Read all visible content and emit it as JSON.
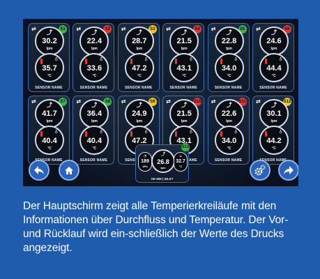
{
  "badge_colors": {
    "green": "#3cb34a",
    "red": "#e0363a",
    "yellow": "#f0c419"
  },
  "sensors": [
    {
      "badge": "S1",
      "badge_color": "green",
      "flow": "30.2",
      "flow_unit": "lpm",
      "temp": "35.7",
      "temp_unit": "°C",
      "name": "SENSOR NAME"
    },
    {
      "badge": "S2",
      "badge_color": "red",
      "flow": "22.4",
      "flow_unit": "lpm",
      "temp": "33.6",
      "temp_unit": "°C",
      "name": "SENSOR NAME"
    },
    {
      "badge": "S3",
      "badge_color": "yellow",
      "flow": "28.7",
      "flow_unit": "lpm",
      "temp": "47.2",
      "temp_unit": "°C",
      "name": "SENSOR NAME"
    },
    {
      "badge": "S4",
      "badge_color": "red",
      "flow": "21.5",
      "flow_unit": "lpm",
      "temp": "43.1",
      "temp_unit": "°C",
      "name": "SENSOR NAME"
    },
    {
      "badge": "S5",
      "badge_color": "green",
      "flow": "22.8",
      "flow_unit": "lpm",
      "temp": "34.0",
      "temp_unit": "°C",
      "name": "SENSOR NAME"
    },
    {
      "badge": "S6",
      "badge_color": "red",
      "flow": "24.6",
      "flow_unit": "lpm",
      "temp": "44.4",
      "temp_unit": "°C",
      "name": "SENSOR NAME"
    },
    {
      "badge": "S7",
      "badge_color": "green",
      "flow": "41.7",
      "flow_unit": "lpm",
      "temp": "40.4",
      "temp_unit": "°C",
      "name": "SENSOR NAME"
    },
    {
      "badge": "S8",
      "badge_color": "green",
      "flow": "36.4",
      "flow_unit": "lpm",
      "temp": "40.4",
      "temp_unit": "°C",
      "name": "SENSOR NAME"
    },
    {
      "badge": "S9",
      "badge_color": "yellow",
      "flow": "24.9",
      "flow_unit": "lpm",
      "temp": "47.2",
      "temp_unit": "°C",
      "name": "SENSOR NAME"
    },
    {
      "badge": "S10",
      "badge_color": "red",
      "flow": "21.5",
      "flow_unit": "lpm",
      "temp": "43.1",
      "temp_unit": "°C",
      "name": "SENSOR NAME"
    },
    {
      "badge": "S11",
      "badge_color": "red",
      "flow": "22.6",
      "flow_unit": "lpm",
      "temp": "34.0",
      "temp_unit": "°C",
      "name": "SENSOR NAME"
    },
    {
      "badge": "S12",
      "badge_color": "yellow",
      "flow": "30.1",
      "flow_unit": "lpm",
      "temp": "44.2",
      "temp_unit": "°C",
      "name": "SENSOR NAME"
    }
  ],
  "inlet": {
    "badge": "S13",
    "badge_color": "green",
    "pressure": "189",
    "pressure_unit": "kPa",
    "flow": "26.8",
    "flow_unit": "lpm",
    "temp": "32.7",
    "temp_unit": "°C",
    "name": "OE MM | INLET"
  },
  "nav": {
    "back_icon": "back-arrow-icon",
    "home_icon": "home-icon",
    "settings_icon": "gear-icon",
    "forward_icon": "forward-arrow-icon"
  },
  "caption": "Der Hauptschirm zeigt alle Temperierkreiläufe mit den Informationen über Durchfluss und Temperatur. Der Vor-und Rücklauf wird ein-schließlich der Werte des Drucks angezeigt."
}
